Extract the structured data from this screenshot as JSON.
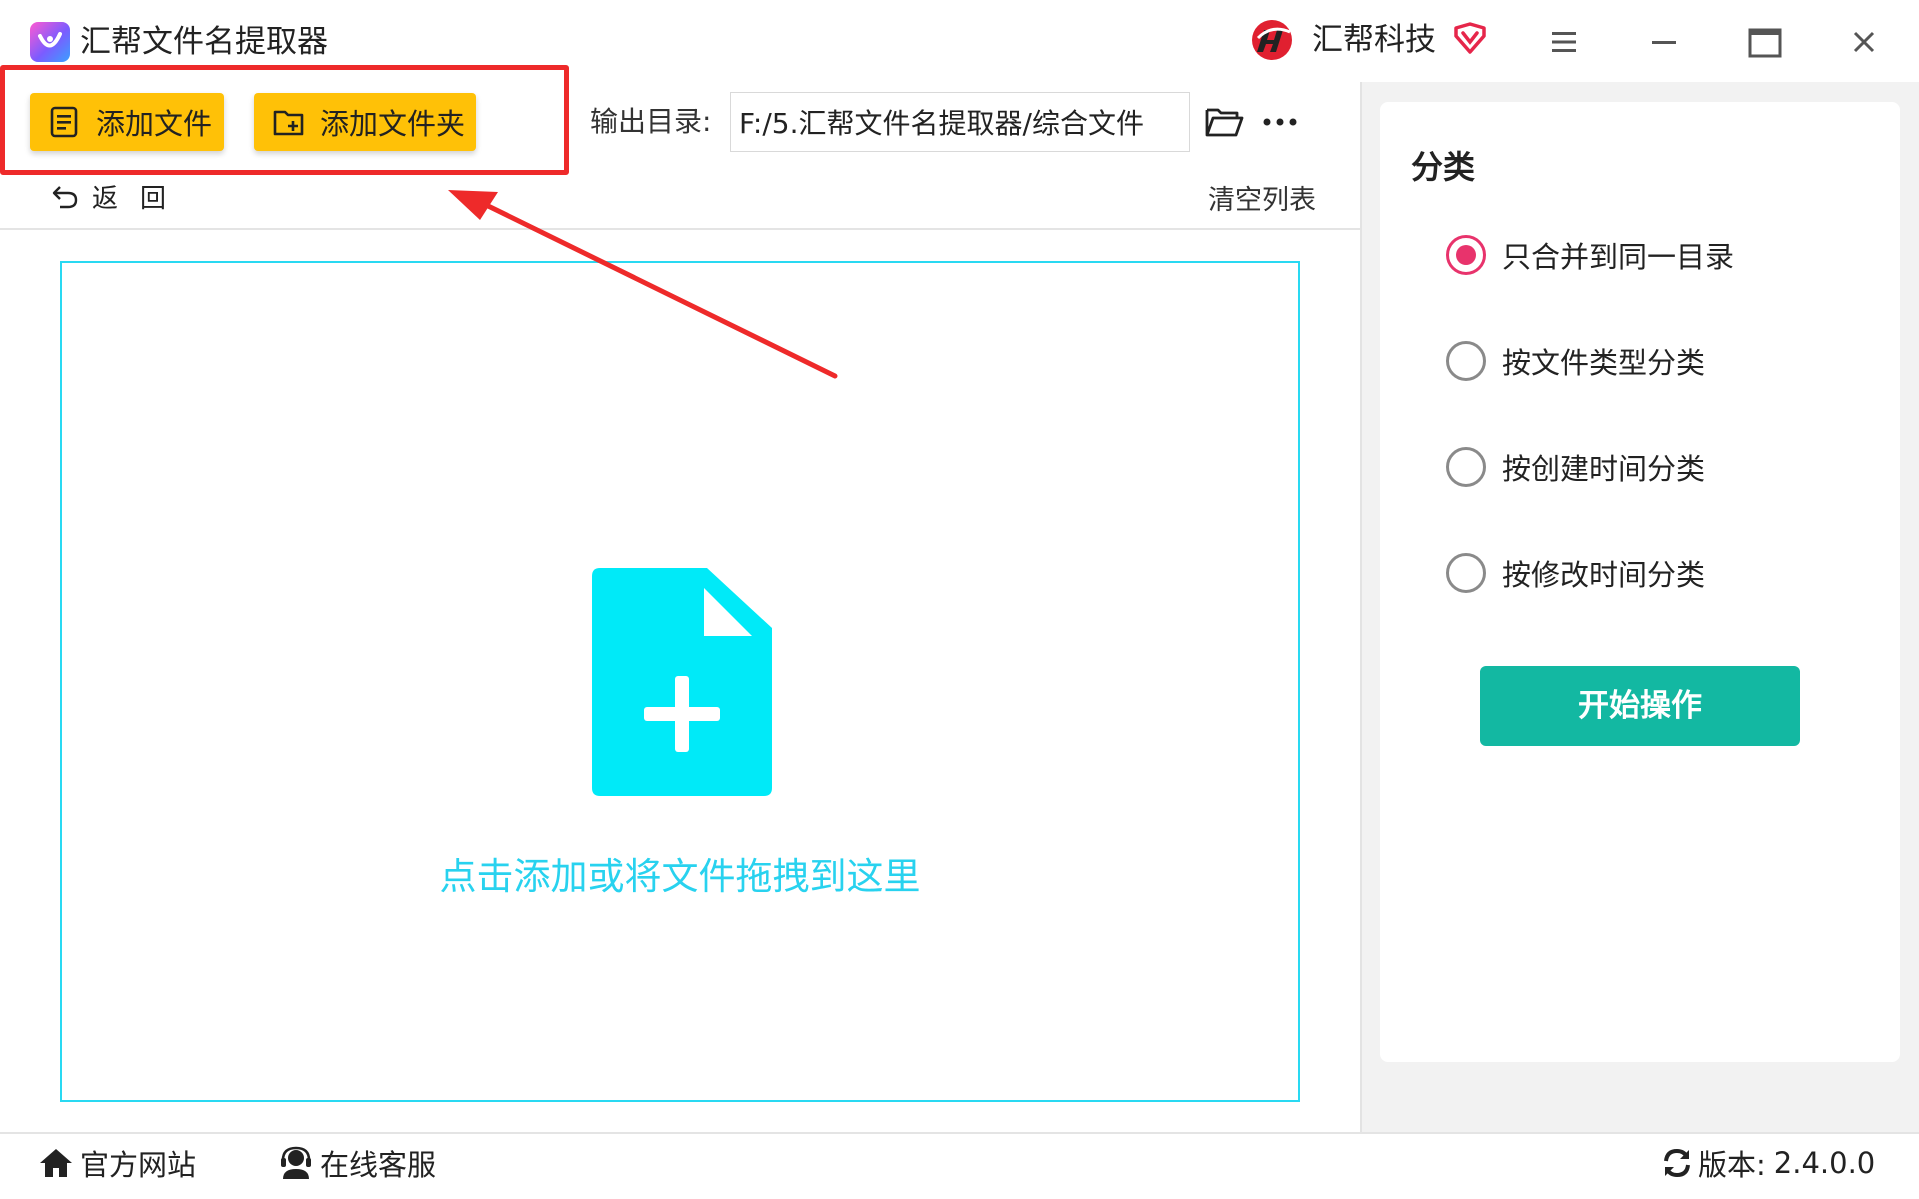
{
  "app": {
    "title": "汇帮文件名提取器",
    "brand": "汇帮科技"
  },
  "toolbar": {
    "add_file_label": "添加文件",
    "add_folder_label": "添加文件夹",
    "output_label": "输出目录:",
    "output_path": "F:/5.汇帮文件名提取器/综合文件",
    "back_label": "返回",
    "clear_list_label": "清空列表"
  },
  "dropzone": {
    "hint": "点击添加或将文件拖拽到这里"
  },
  "panel": {
    "title": "分类",
    "options": [
      {
        "label": "只合并到同一目录",
        "checked": true
      },
      {
        "label": "按文件类型分类",
        "checked": false
      },
      {
        "label": "按创建时间分类",
        "checked": false
      },
      {
        "label": "按修改时间分类",
        "checked": false
      }
    ],
    "start_label": "开始操作"
  },
  "footer": {
    "website_label": "官方网站",
    "support_label": "在线客服",
    "version_label": "版本:",
    "version": "2.4.0.0"
  },
  "colors": {
    "highlight": "#ee2a2a",
    "button_yellow": "#ffc107",
    "dropzone_cyan": "#29d9f2",
    "radio_active": "#e8336c",
    "start_button": "#13b8a2"
  },
  "icons": [
    "app-logo-icon",
    "brand-logo-icon",
    "vip-heart-icon",
    "menu-icon",
    "minimize-icon",
    "maximize-icon",
    "close-icon",
    "add-file-icon",
    "add-folder-icon",
    "folder-open-icon",
    "more-icon",
    "undo-icon",
    "file-plus-icon",
    "home-icon",
    "headset-icon",
    "refresh-icon"
  ]
}
